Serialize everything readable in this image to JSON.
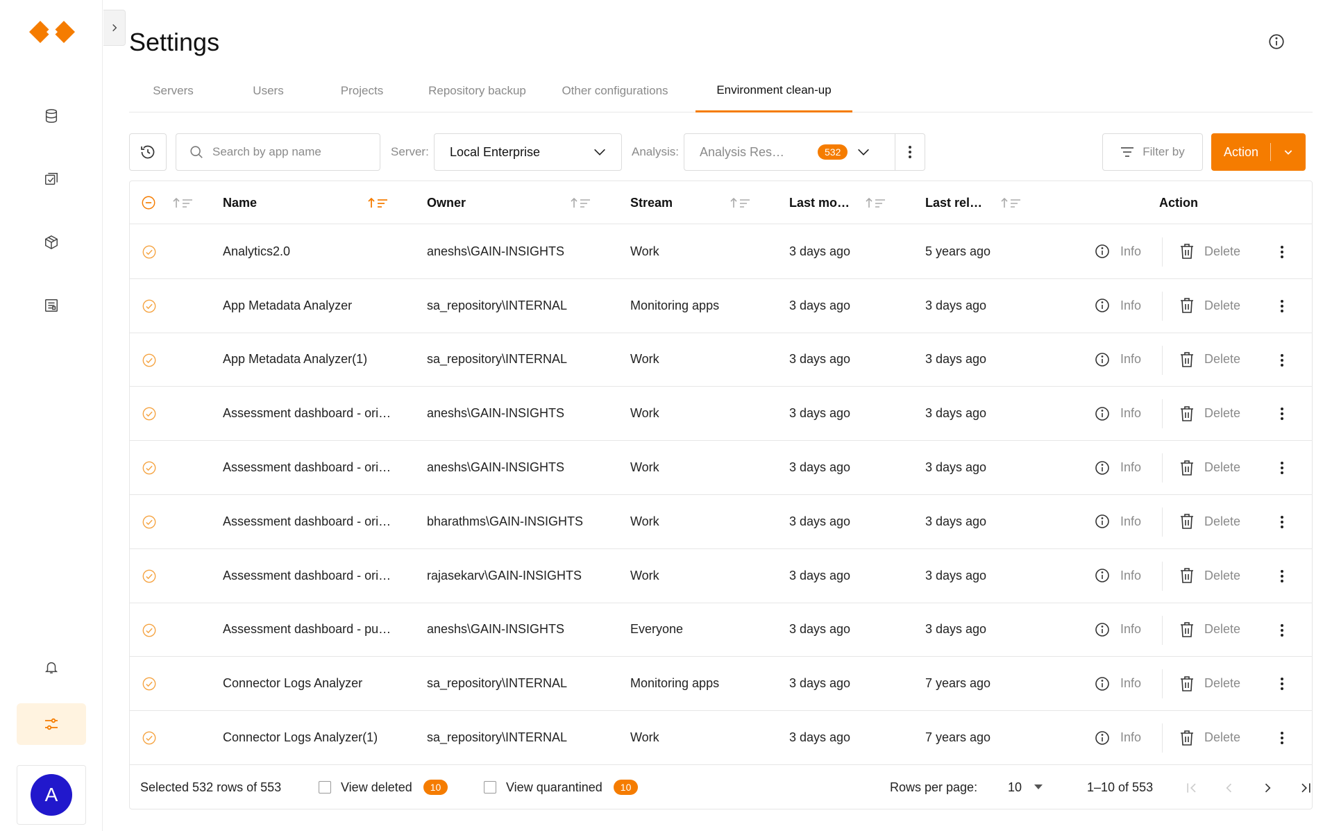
{
  "page": {
    "title": "Settings"
  },
  "tabs": [
    {
      "label": "Servers"
    },
    {
      "label": "Users"
    },
    {
      "label": "Projects"
    },
    {
      "label": "Repository backup"
    },
    {
      "label": "Other configurations"
    },
    {
      "label": "Environment clean-up",
      "active": true
    }
  ],
  "toolbar": {
    "search_placeholder": "Search by app name",
    "server_label": "Server:",
    "server_value": "Local Enterprise",
    "analysis_label": "Analysis:",
    "analysis_value": "Analysis Res…",
    "analysis_count": "532",
    "filter_label": "Filter by",
    "action_label": "Action",
    "accent_color": "#f57c00"
  },
  "table": {
    "columns": {
      "name": "Name",
      "owner": "Owner",
      "stream": "Stream",
      "last_modified": "Last mo…",
      "last_reloaded": "Last rel…",
      "action": "Action"
    },
    "info_label": "Info",
    "delete_label": "Delete",
    "rows": [
      {
        "name": "Analytics2.0",
        "owner": "aneshs\\GAIN-INSIGHTS",
        "stream": "Work",
        "last_modified": "3 days ago",
        "last_reloaded": "5 years ago"
      },
      {
        "name": "App Metadata Analyzer",
        "owner": "sa_repository\\INTERNAL",
        "stream": "Monitoring apps",
        "last_modified": "3 days ago",
        "last_reloaded": "3 days ago"
      },
      {
        "name": "App Metadata Analyzer(1)",
        "owner": "sa_repository\\INTERNAL",
        "stream": "Work",
        "last_modified": "3 days ago",
        "last_reloaded": "3 days ago"
      },
      {
        "name": "Assessment dashboard - ori…",
        "owner": "aneshs\\GAIN-INSIGHTS",
        "stream": "Work",
        "last_modified": "3 days ago",
        "last_reloaded": "3 days ago"
      },
      {
        "name": "Assessment dashboard - ori…",
        "owner": "aneshs\\GAIN-INSIGHTS",
        "stream": "Work",
        "last_modified": "3 days ago",
        "last_reloaded": "3 days ago"
      },
      {
        "name": "Assessment dashboard - ori…",
        "owner": "bharathms\\GAIN-INSIGHTS",
        "stream": "Work",
        "last_modified": "3 days ago",
        "last_reloaded": "3 days ago"
      },
      {
        "name": "Assessment dashboard - ori…",
        "owner": "rajasekarv\\GAIN-INSIGHTS",
        "stream": "Work",
        "last_modified": "3 days ago",
        "last_reloaded": "3 days ago"
      },
      {
        "name": "Assessment dashboard - pu…",
        "owner": "aneshs\\GAIN-INSIGHTS",
        "stream": "Everyone",
        "last_modified": "3 days ago",
        "last_reloaded": "3 days ago"
      },
      {
        "name": "Connector Logs Analyzer",
        "owner": "sa_repository\\INTERNAL",
        "stream": "Monitoring apps",
        "last_modified": "3 days ago",
        "last_reloaded": "7 years ago"
      },
      {
        "name": "Connector Logs Analyzer(1)",
        "owner": "sa_repository\\INTERNAL",
        "stream": "Work",
        "last_modified": "3 days ago",
        "last_reloaded": "7 years ago"
      }
    ]
  },
  "footer": {
    "selected_text": "Selected 532 rows of 553",
    "view_deleted_label": "View deleted",
    "view_deleted_count": "10",
    "view_quarantined_label": "View quarantined",
    "view_quarantined_count": "10",
    "rows_per_page_label": "Rows per page:",
    "rows_per_page_value": "10",
    "range_text": "1–10 of 553"
  },
  "user": {
    "avatar_initial": "A"
  }
}
